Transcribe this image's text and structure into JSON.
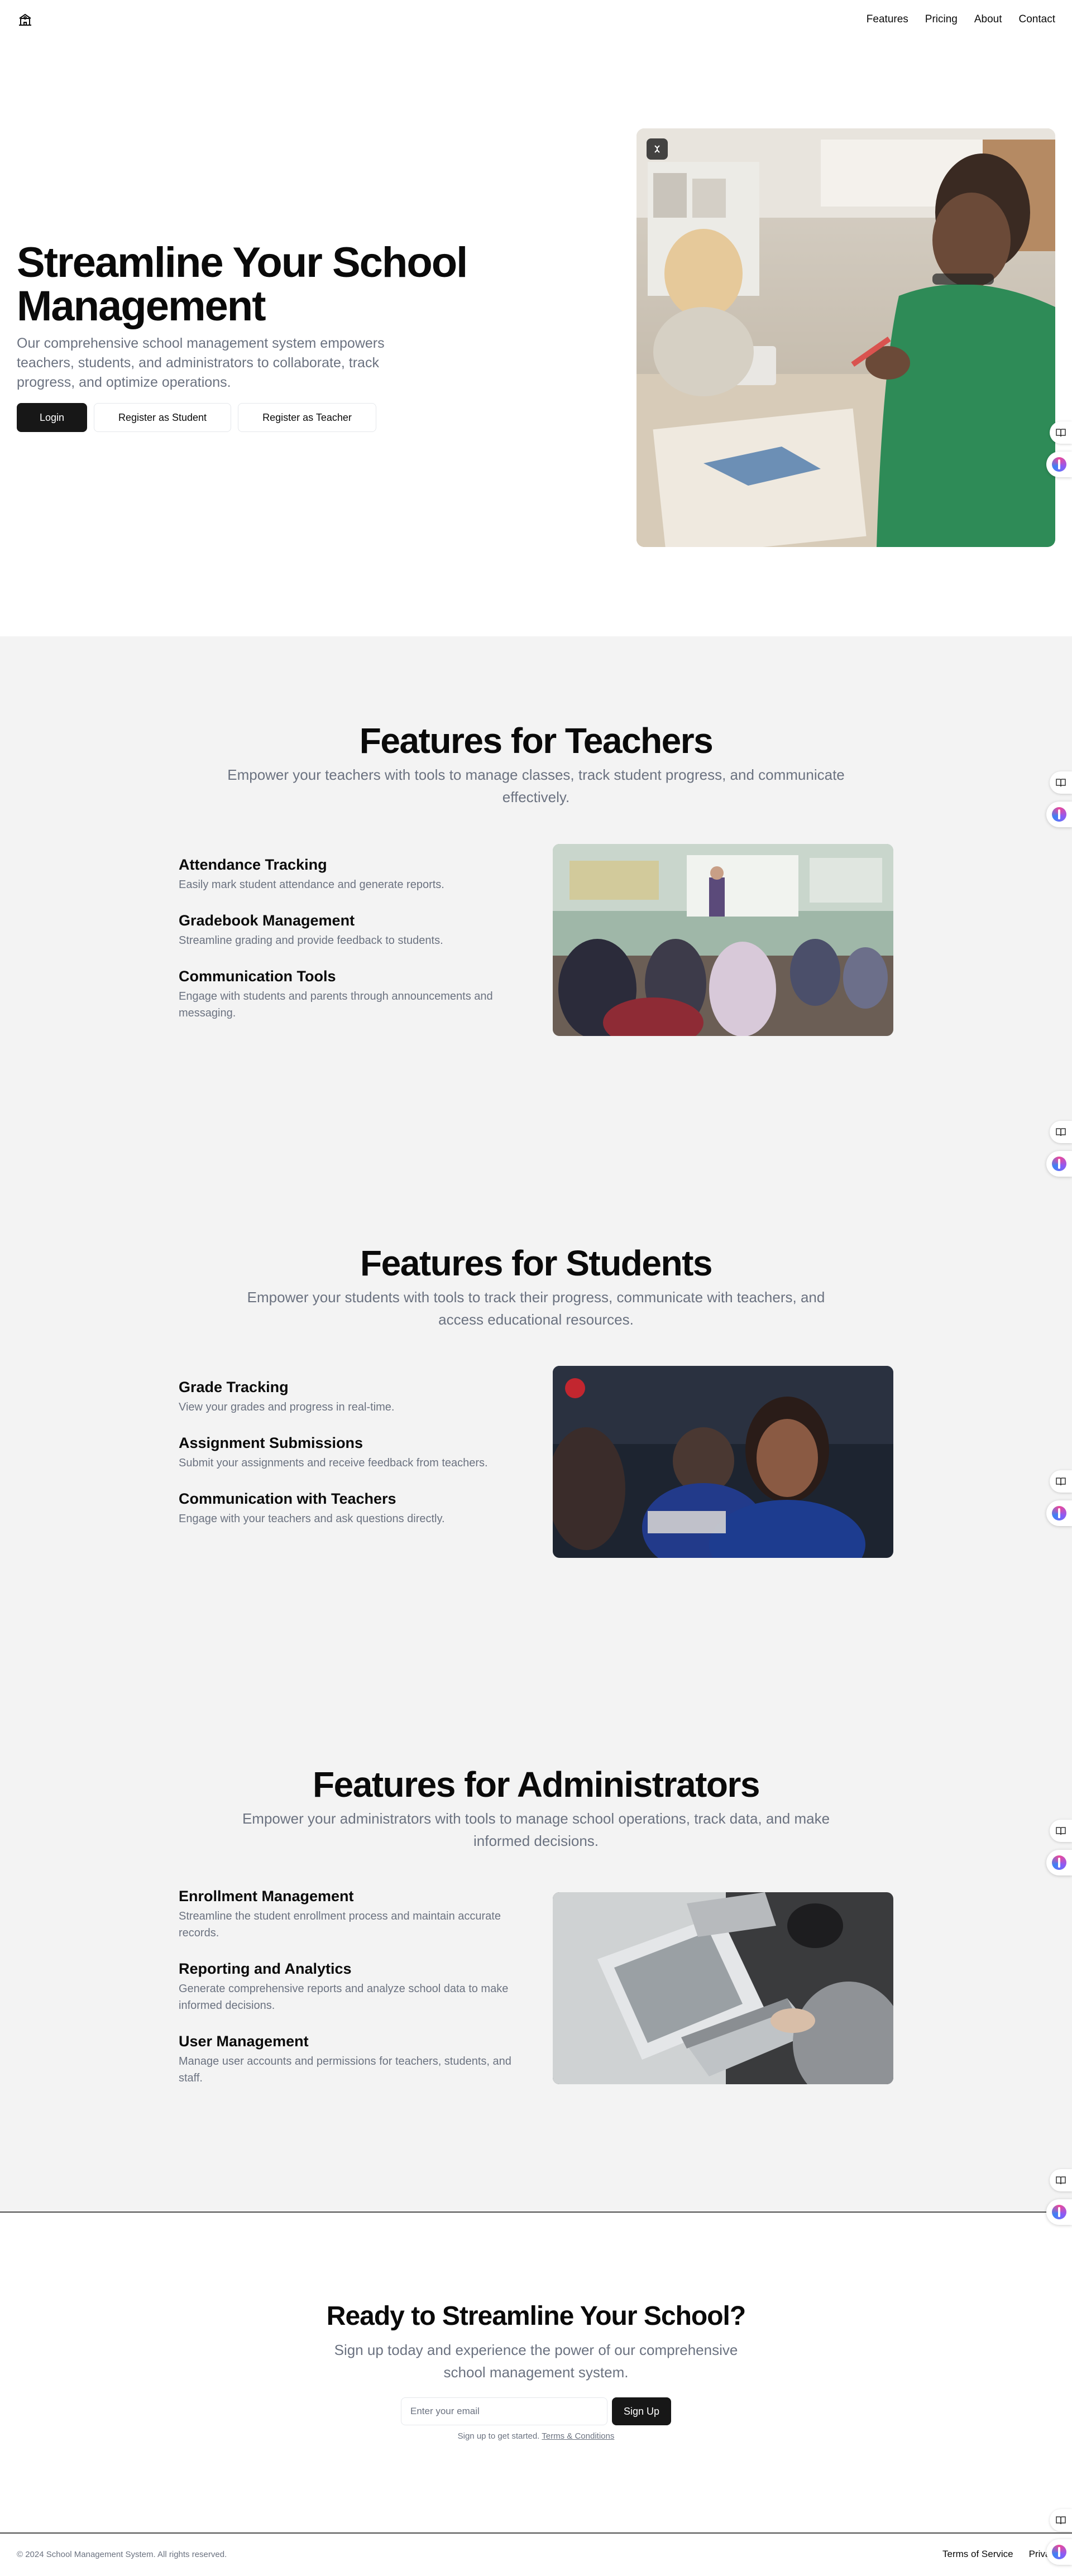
{
  "header": {
    "logo_icon": "school-building-icon",
    "nav": [
      {
        "label": "Features"
      },
      {
        "label": "Pricing"
      },
      {
        "label": "About"
      },
      {
        "label": "Contact"
      }
    ]
  },
  "hero": {
    "title": "Streamline Your School Management",
    "description": "Our comprehensive school management system empowers teachers, students, and administrators to collaborate, track progress, and optimize operations.",
    "buttons": {
      "login": "Login",
      "register_student": "Register as Student",
      "register_teacher": "Register as Teacher"
    },
    "image_icon": "image-badge-icon"
  },
  "sections": [
    {
      "title": "Features for Teachers",
      "subtitle": "Empower your teachers with tools to manage classes, track student progress, and communicate effectively.",
      "features": [
        {
          "title": "Attendance Tracking",
          "desc": "Easily mark student attendance and generate reports."
        },
        {
          "title": "Gradebook Management",
          "desc": "Streamline grading and provide feedback to students."
        },
        {
          "title": "Communication Tools",
          "desc": "Engage with students and parents through announcements and messaging."
        }
      ]
    },
    {
      "title": "Features for Students",
      "subtitle": "Empower your students with tools to track their progress, communicate with teachers, and access educational resources.",
      "features": [
        {
          "title": "Grade Tracking",
          "desc": "View your grades and progress in real-time."
        },
        {
          "title": "Assignment Submissions",
          "desc": "Submit your assignments and receive feedback from teachers."
        },
        {
          "title": "Communication with Teachers",
          "desc": "Engage with your teachers and ask questions directly."
        }
      ]
    },
    {
      "title": "Features for Administrators",
      "subtitle": "Empower your administrators with tools to manage school operations, track data, and make informed decisions.",
      "features": [
        {
          "title": "Enrollment Management",
          "desc": "Streamline the student enrollment process and maintain accurate records."
        },
        {
          "title": "Reporting and Analytics",
          "desc": "Generate comprehensive reports and analyze school data to make informed decisions."
        },
        {
          "title": "User Management",
          "desc": "Manage user accounts and permissions for teachers, students, and staff."
        }
      ]
    }
  ],
  "cta": {
    "title": "Ready to Streamline Your School?",
    "subtitle": "Sign up today and experience the power of our comprehensive school management system.",
    "email_placeholder": "Enter your email",
    "button": "Sign Up",
    "note": "Sign up to get started.",
    "terms_link": "Terms & Conditions"
  },
  "footer": {
    "copyright": "© 2024 School Management System. All rights reserved.",
    "links": [
      "Terms of Service",
      "Privacy"
    ]
  },
  "widgets": {
    "book_icon": "book-icon",
    "brain_icon": "brain-icon"
  }
}
